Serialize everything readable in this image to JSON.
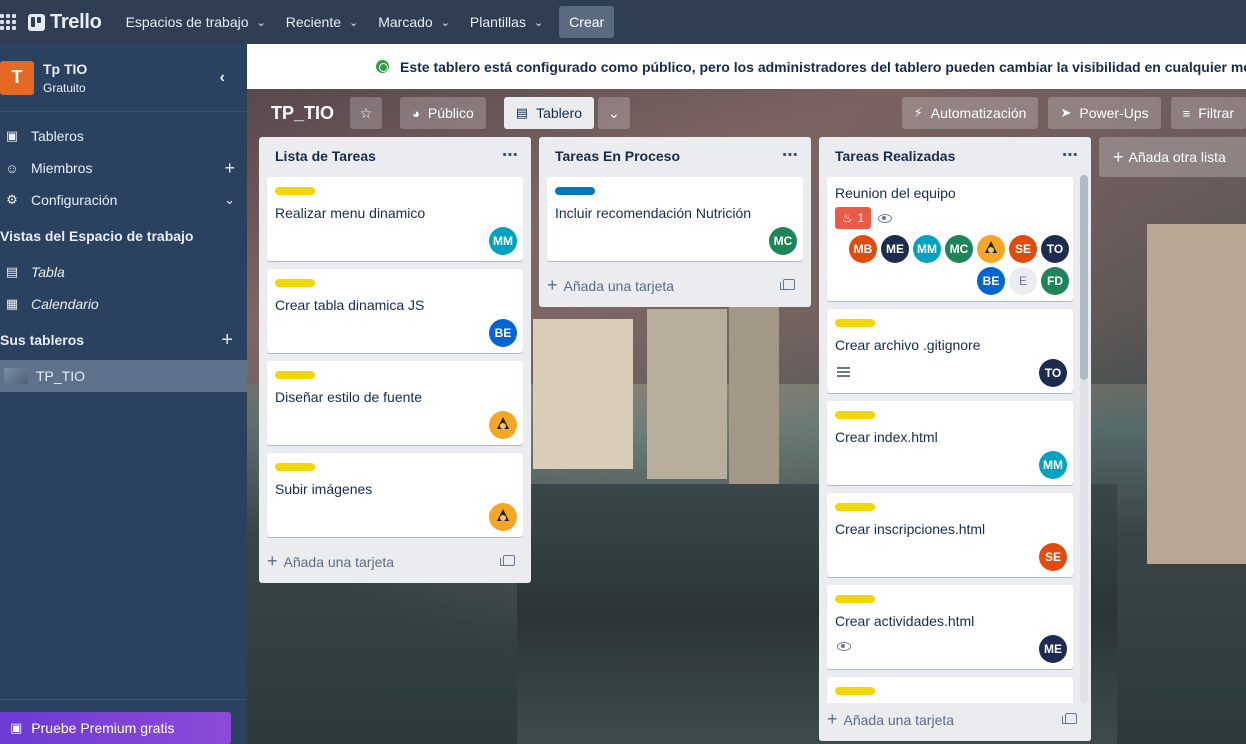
{
  "topbar": {
    "logo": "Trello",
    "nav": [
      "Espacios de trabajo",
      "Reciente",
      "Marcado",
      "Plantillas"
    ],
    "create": "Crear"
  },
  "sidebar": {
    "workspace_initial": "T",
    "workspace_name": "Tp TIO",
    "workspace_plan": "Gratuito",
    "items": [
      {
        "label": "Tableros",
        "icon": "board-icon"
      },
      {
        "label": "Miembros",
        "icon": "person-icon",
        "action": "+"
      },
      {
        "label": "Configuración",
        "icon": "gear-icon",
        "action": "chevron"
      }
    ],
    "views_title": "Vistas del Espacio de trabajo",
    "views": [
      {
        "label": "Tabla",
        "icon": "table-icon"
      },
      {
        "label": "Calendario",
        "icon": "calendar-icon"
      }
    ],
    "boards_title": "Sus tableros",
    "boards": [
      "TP_TIO"
    ],
    "premium": "Pruebe Premium gratis"
  },
  "banner": "Este tablero está configurado como público, pero los administradores del tablero pueden cambiar la visibilidad en cualquier mom",
  "board": {
    "title": "TP_TIO",
    "visibility": "Público",
    "view": "Tablero",
    "automation": "Automatización",
    "powerups": "Power-Ups",
    "filter": "Filtrar",
    "add_list": "Añada otra lista"
  },
  "colors": {
    "label_yellow": "#f2d600",
    "label_blue": "#0079bf",
    "mm": "#00a3bf",
    "be": "#0065d4",
    "mc": "#1f845a",
    "to": "#1d2b4f",
    "me": "#1d2b4f",
    "se": "#e34a0e",
    "mb": "#e34a0e",
    "fd": "#1f845a"
  },
  "lists": [
    {
      "title": "Lista de Tareas",
      "add_card": "Añada una tarjeta",
      "cards": [
        {
          "title": "Realizar menu dinamico",
          "member": "MM"
        },
        {
          "title": "Crear tabla dinamica JS",
          "member": "BE"
        },
        {
          "title": "Diseñar estilo de fuente",
          "member": "avatar-img"
        },
        {
          "title": "Subir imágenes",
          "member": "avatar-img"
        }
      ]
    },
    {
      "title": "Tareas En Proceso",
      "add_card": "Añada una tarjeta",
      "cards": [
        {
          "title": "Incluir recomendación Nutrición",
          "member": "MC"
        }
      ]
    },
    {
      "title": "Tareas Realizadas",
      "add_card": "Añada una tarjeta",
      "cards": [
        {
          "title": "Reunion del equipo",
          "notifications": "1",
          "members": [
            "MB",
            "ME",
            "MM",
            "MC",
            "img",
            "SE",
            "TO",
            "BE",
            "E",
            "FD"
          ]
        },
        {
          "title": "Crear archivo .gitignore",
          "member": "TO"
        },
        {
          "title": "Crear index.html",
          "member": "MM"
        },
        {
          "title": "Crear inscripciones.html",
          "member": "SE"
        },
        {
          "title": "Crear actividades.html",
          "member": "ME"
        }
      ]
    }
  ]
}
